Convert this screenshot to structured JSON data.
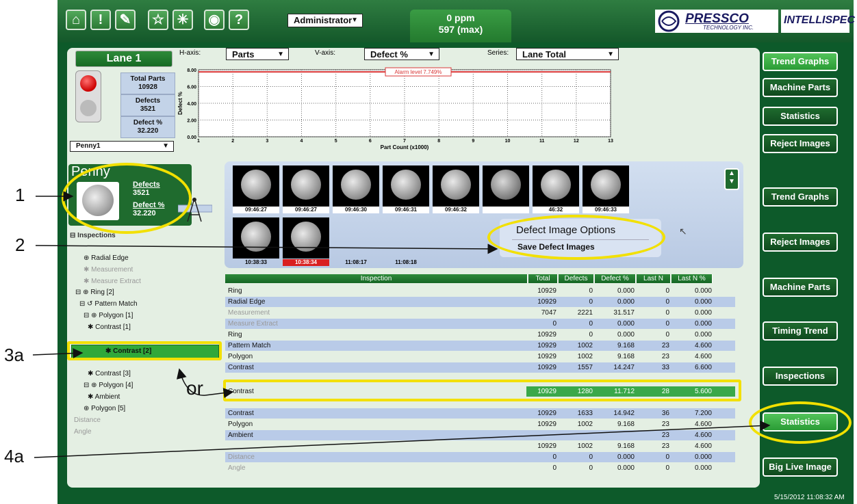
{
  "topbar": {
    "user_select": "Administrator",
    "ppm_current": "0 ppm",
    "ppm_max": "597 (max)",
    "logo_pressco": "PRESSCO",
    "logo_pressco_sub": "TECHNOLOGY INC.",
    "logo_intellispec": "INTELLISPEC",
    "buttons": [
      "home-icon",
      "exclamation-icon",
      "wrench-icon",
      "star-icon",
      "magic-wand-icon",
      "globe-icon",
      "question-icon"
    ],
    "button_glyphs": [
      "⌂",
      "!",
      "✎",
      "☆",
      "✳",
      "◉",
      "?"
    ]
  },
  "lane": {
    "title": "Lane 1",
    "total_parts_label": "Total Parts",
    "total_parts": "10928",
    "defects_label": "Defects",
    "defects": "3521",
    "defect_pct_label": "Defect %",
    "defect_pct": "32.220",
    "product_select": "Penny1"
  },
  "axes_controls": {
    "h_label": "H-axis:",
    "h_value": "Parts",
    "v_label": "V-axis:",
    "v_value": "Defect %",
    "series_label": "Series:",
    "series_value": "Lane Total"
  },
  "chart_data": {
    "type": "line",
    "xlabel": "Part Count (x1000)",
    "ylabel": "Defect %",
    "x_ticks": [
      "1",
      "2",
      "3",
      "4",
      "5",
      "6",
      "7",
      "8",
      "9",
      "10",
      "11",
      "12",
      "13"
    ],
    "y_ticks": [
      "0.00",
      "2.00",
      "4.00",
      "6.00",
      "8.00"
    ],
    "ylim": [
      0,
      8
    ],
    "xlim": [
      1,
      13
    ],
    "alarm_level": 7.749,
    "alarm_label": "Alarm level 7.749%",
    "alarm_color": "#d93636",
    "grid": true
  },
  "penny_panel": {
    "title": "Penny",
    "defects_label": "Defects",
    "defects": "3521",
    "defect_pct_label": "Defect %",
    "defect_pct": "32.220"
  },
  "inspections_label": "Inspections",
  "tree": [
    {
      "label": "⊕ Radial Edge",
      "dim": false
    },
    {
      "label": "✱ Measurement",
      "dim": true
    },
    {
      "label": "✱ Measure Extract",
      "dim": true
    },
    {
      "label": "⊟ ⊕ Ring [2]",
      "dim": false
    },
    {
      "label": "⊟ ↺ Pattern Match",
      "dim": false
    },
    {
      "label": "⊟ ⊕ Polygon [1]",
      "dim": false
    },
    {
      "label": "✱ Contrast [1]",
      "dim": false
    },
    {
      "label": "✱ Contrast [2]",
      "dim": false
    },
    {
      "label": "✱ Contrast [3]",
      "dim": false
    },
    {
      "label": "⊟ ⊕ Polygon [4]",
      "dim": false
    },
    {
      "label": "✱ Ambient",
      "dim": false
    },
    {
      "label": "⊕ Polygon [5]",
      "dim": false
    },
    {
      "label": "Distance",
      "dim": true
    },
    {
      "label": "Angle",
      "dim": true
    }
  ],
  "thumbnails": {
    "row1": [
      "09:46:27",
      "09:46:27",
      "09:46:30",
      "09:46:31",
      "09:46:32",
      "",
      "46:32",
      "09:46:33"
    ],
    "row2": [
      "10:38:33",
      "10:38:34",
      "11:08:17",
      "11:08:18"
    ]
  },
  "defect_options": {
    "title": "Defect Image Options",
    "save": "Save Defect Images"
  },
  "table": {
    "headers": [
      "Inspection",
      "Total",
      "Defects",
      "Defect %",
      "Last N",
      "Last N %"
    ],
    "rows": [
      [
        "Ring",
        "10929",
        "0",
        "0.000",
        "0",
        "0.000"
      ],
      [
        "Radial Edge",
        "10929",
        "0",
        "0.000",
        "0",
        "0.000"
      ],
      [
        "Measurement",
        "7047",
        "2221",
        "31.517",
        "0",
        "0.000"
      ],
      [
        "Measure Extract",
        "0",
        "0",
        "0.000",
        "0",
        "0.000"
      ],
      [
        "Ring",
        "10929",
        "0",
        "0.000",
        "0",
        "0.000"
      ],
      [
        "Pattern Match",
        "10929",
        "1002",
        "9.168",
        "23",
        "4.600"
      ],
      [
        "Polygon",
        "10929",
        "1002",
        "9.168",
        "23",
        "4.600"
      ],
      [
        "Contrast",
        "10929",
        "1557",
        "14.247",
        "33",
        "6.600"
      ],
      [
        "Contrast",
        "10929",
        "1280",
        "11.712",
        "28",
        "5.600"
      ],
      [
        "Contrast",
        "10929",
        "1633",
        "14.942",
        "36",
        "7.200"
      ],
      [
        "Polygon",
        "10929",
        "1002",
        "9.168",
        "23",
        "4.600"
      ],
      [
        "Ambient",
        "",
        "",
        "",
        "23",
        "4.600"
      ],
      [
        "",
        "10929",
        "1002",
        "9.168",
        "23",
        "4.600"
      ],
      [
        "Distance",
        "0",
        "0",
        "0.000",
        "0",
        "0.000"
      ],
      [
        "Angle",
        "0",
        "0",
        "0.000",
        "0",
        "0.000"
      ]
    ]
  },
  "right_top_buttons": [
    "Trend Graphs",
    "Machine Parts",
    "Statistics",
    "Reject Images"
  ],
  "right_bottom_buttons": [
    "Trend Graphs",
    "Reject Images",
    "Machine Parts",
    "Timing Trend",
    "Inspections",
    "Statistics",
    "Big Live Image"
  ],
  "timestamp": "5/15/2012 11:08:32 AM",
  "callouts": {
    "c1": "1",
    "c2": "2",
    "c3a": "3a",
    "c4a": "4a",
    "or": "or"
  },
  "colors": {
    "app_green": "#0d5a2a",
    "highlight": "#f2e000",
    "active_button": "#3fb04a"
  }
}
